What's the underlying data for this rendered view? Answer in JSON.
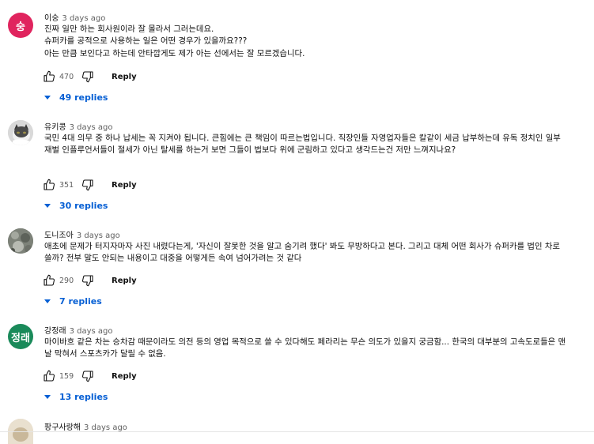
{
  "colors": {
    "link": "#065fd4",
    "secondary": "#606060",
    "text": "#0f0f0f"
  },
  "comments": [
    {
      "author": "이숭",
      "time": "3 days ago",
      "avatar": {
        "type": "letter",
        "letter": "숭",
        "color": "#e0245e"
      },
      "text": "진짜 일만 하는 회사원이라 잘 몰라서 그러는데요.\n슈퍼카를 공적으로 사용하는 일은 어떤 경우가 있을까요???\n아는 만큼 보인다고 하는데 안타깝게도 제가 아는 선에서는 잘 모르겠습니다.",
      "likes": "470",
      "reply_label": "Reply",
      "replies_label": "49 replies"
    },
    {
      "author": "유키콩",
      "time": "3 days ago",
      "avatar": {
        "type": "photo",
        "icon": "cat-avatar-icon",
        "color": "#d6d6d6"
      },
      "text": "국민 4대 의무 중 하나 납세는 꼭 지켜야 됩니다.  큰힘에는 큰 책임이 따르는법입니다. 직장인들 자영업자들은 칼같이 세금 납부하는데 유독 정치인 일부 재벌 인플루언서들이 절세가 아닌 탈세를 하는거 보면 그들이 법보다 위에 군림하고 있다고 생각드는건 저만 느껴지나요?",
      "likes": "351",
      "reply_label": "Reply",
      "replies_label": "30 replies"
    },
    {
      "author": "도니조아",
      "time": "3 days ago",
      "avatar": {
        "type": "photo",
        "icon": "pattern-avatar-icon",
        "color": "#8a8f86"
      },
      "text": "애초에 문제가 터지자마자 사진 내렸다는게, '자신이 잘못한 것을 알고 숨기려 했다' 봐도 무방하다고 본다. 그리고 대체 어떤 회사가 슈퍼카를 법인 차로 쓸까? 전부 말도 안되는 내용이고 대중을 어떻게든 속여 넘어가려는 것 같다",
      "likes": "290",
      "reply_label": "Reply",
      "replies_label": "7 replies"
    },
    {
      "author": "강정래",
      "time": "3 days ago",
      "avatar": {
        "type": "letter",
        "letter": "정래",
        "color": "#1a8a5a"
      },
      "text": "마이바흐 같은 차는 승차감 때문이라도 의전  등의 영업 목적으로 쓸 수 있다해도 페라리는 무슨 의도가 있을지 궁금함... 한국의 대부분의 고속도로들은 맨날 막혀서 스포츠카가 달릴 수 없음.",
      "likes": "159",
      "reply_label": "Reply",
      "replies_label": "13 replies"
    },
    {
      "author": "팡구사랑해",
      "time": "3 days ago",
      "avatar": {
        "type": "photo",
        "icon": "partial-avatar-icon",
        "color": "#e9e0cf"
      }
    }
  ]
}
